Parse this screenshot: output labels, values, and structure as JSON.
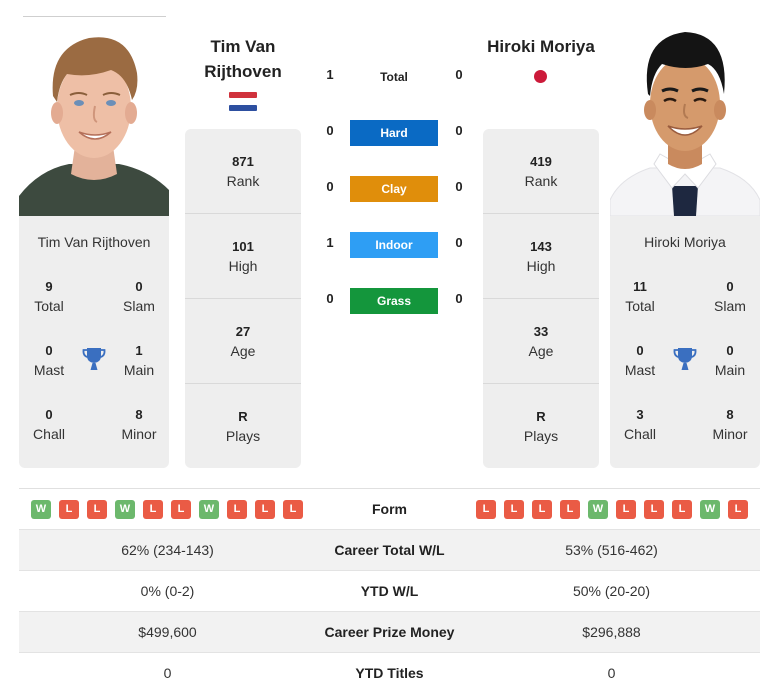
{
  "players": {
    "left": {
      "name": "Tim Van Rijthoven",
      "name_heading_line1": "Tim Van",
      "name_heading_line2": "Rijthoven",
      "country": "Netherlands",
      "flag_icon": "netherlands-flag-icon",
      "titles": {
        "total": {
          "value": "9",
          "label": "Total"
        },
        "slam": {
          "value": "0",
          "label": "Slam"
        },
        "mast": {
          "value": "0",
          "label": "Mast"
        },
        "main": {
          "value": "1",
          "label": "Main"
        },
        "chall": {
          "value": "0",
          "label": "Chall"
        },
        "minor": {
          "value": "8",
          "label": "Minor"
        }
      },
      "rank": {
        "value": "871",
        "label": "Rank"
      },
      "high": {
        "value": "101",
        "label": "High"
      },
      "age": {
        "value": "27",
        "label": "Age"
      },
      "plays": {
        "value": "R",
        "label": "Plays"
      }
    },
    "right": {
      "name": "Hiroki Moriya",
      "country": "Japan",
      "flag_icon": "japan-flag-icon",
      "titles": {
        "total": {
          "value": "11",
          "label": "Total"
        },
        "slam": {
          "value": "0",
          "label": "Slam"
        },
        "mast": {
          "value": "0",
          "label": "Mast"
        },
        "main": {
          "value": "0",
          "label": "Main"
        },
        "chall": {
          "value": "3",
          "label": "Chall"
        },
        "minor": {
          "value": "8",
          "label": "Minor"
        }
      },
      "rank": {
        "value": "419",
        "label": "Rank"
      },
      "high": {
        "value": "143",
        "label": "High"
      },
      "age": {
        "value": "33",
        "label": "Age"
      },
      "plays": {
        "value": "R",
        "label": "Plays"
      }
    }
  },
  "h2h": {
    "total": {
      "label": "Total",
      "left": "1",
      "right": "0"
    },
    "surfaces": [
      {
        "label": "Hard",
        "left": "0",
        "right": "0",
        "color": "#0a6ac4"
      },
      {
        "label": "Clay",
        "left": "0",
        "right": "0",
        "color": "#e08e0b"
      },
      {
        "label": "Indoor",
        "left": "1",
        "right": "0",
        "color": "#2e9ef4"
      },
      {
        "label": "Grass",
        "left": "0",
        "right": "0",
        "color": "#14963c"
      }
    ]
  },
  "comparison": {
    "form": {
      "label": "Form",
      "left": [
        "W",
        "L",
        "L",
        "W",
        "L",
        "L",
        "W",
        "L",
        "L",
        "L"
      ],
      "right": [
        "L",
        "L",
        "L",
        "L",
        "W",
        "L",
        "L",
        "L",
        "W",
        "L"
      ]
    },
    "rows": [
      {
        "label": "Career Total W/L",
        "left": "62% (234-143)",
        "right": "53% (516-462)"
      },
      {
        "label": "YTD W/L",
        "left": "0% (0-2)",
        "right": "50% (20-20)"
      },
      {
        "label": "Career Prize Money",
        "left": "$499,600",
        "right": "$296,888"
      },
      {
        "label": "YTD Titles",
        "left": "0",
        "right": "0"
      }
    ]
  },
  "colors": {
    "win": "#6cb86c",
    "loss": "#ea5b45",
    "trophy": "#3a6fc0",
    "card_bg": "#eeeeee"
  }
}
